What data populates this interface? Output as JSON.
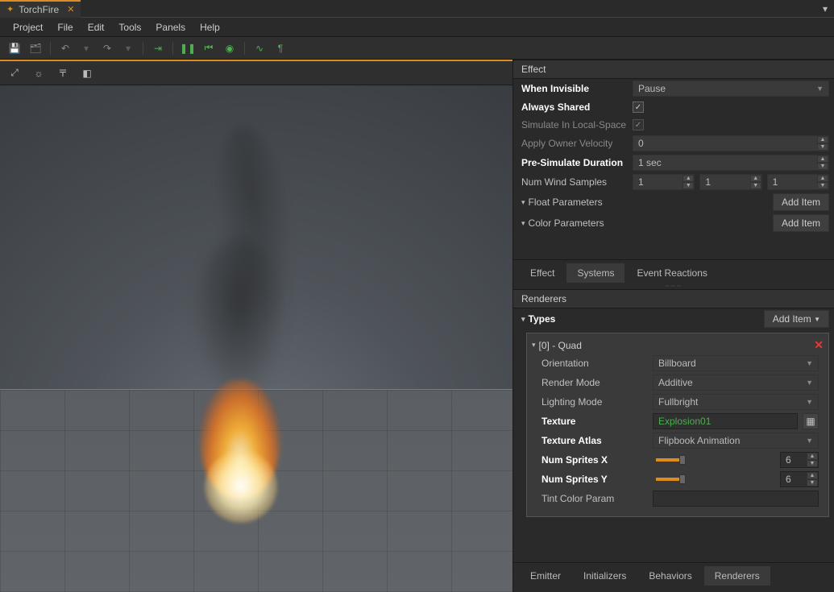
{
  "titlebar": {
    "tab_name": "TorchFire"
  },
  "menu": {
    "project": "Project",
    "file": "File",
    "edit": "Edit",
    "tools": "Tools",
    "panels": "Panels",
    "help": "Help"
  },
  "effect_panel": {
    "header": "Effect",
    "when_invisible_label": "When Invisible",
    "when_invisible_value": "Pause",
    "always_shared_label": "Always Shared",
    "always_shared_checked": true,
    "simulate_local_label": "Simulate In Local-Space",
    "simulate_local_checked": true,
    "apply_owner_velocity_label": "Apply Owner Velocity",
    "apply_owner_velocity_value": "0",
    "pre_simulate_label": "Pre-Simulate Duration",
    "pre_simulate_value": "1 sec",
    "num_wind_label": "Num Wind Samples",
    "num_wind_values": [
      "1",
      "1",
      "1"
    ],
    "float_params_label": "Float Parameters",
    "color_params_label": "Color Parameters",
    "add_item_btn": "Add Item"
  },
  "mid_tabs": {
    "effect": "Effect",
    "systems": "Systems",
    "event_reactions": "Event Reactions"
  },
  "renderers": {
    "header": "Renderers",
    "types_label": "Types",
    "add_item_btn": "Add Item",
    "item0": {
      "name": "[0] - Quad",
      "orientation_label": "Orientation",
      "orientation_value": "Billboard",
      "render_mode_label": "Render Mode",
      "render_mode_value": "Additive",
      "lighting_mode_label": "Lighting Mode",
      "lighting_mode_value": "Fullbright",
      "texture_label": "Texture",
      "texture_value": "Explosion01",
      "texture_atlas_label": "Texture Atlas",
      "texture_atlas_value": "Flipbook Animation",
      "num_sprites_x_label": "Num Sprites X",
      "num_sprites_x_value": "6",
      "num_sprites_y_label": "Num Sprites Y",
      "num_sprites_y_value": "6",
      "tint_color_label": "Tint Color Param"
    }
  },
  "bottom_tabs": {
    "emitter": "Emitter",
    "initializers": "Initializers",
    "behaviors": "Behaviors",
    "renderers": "Renderers"
  }
}
